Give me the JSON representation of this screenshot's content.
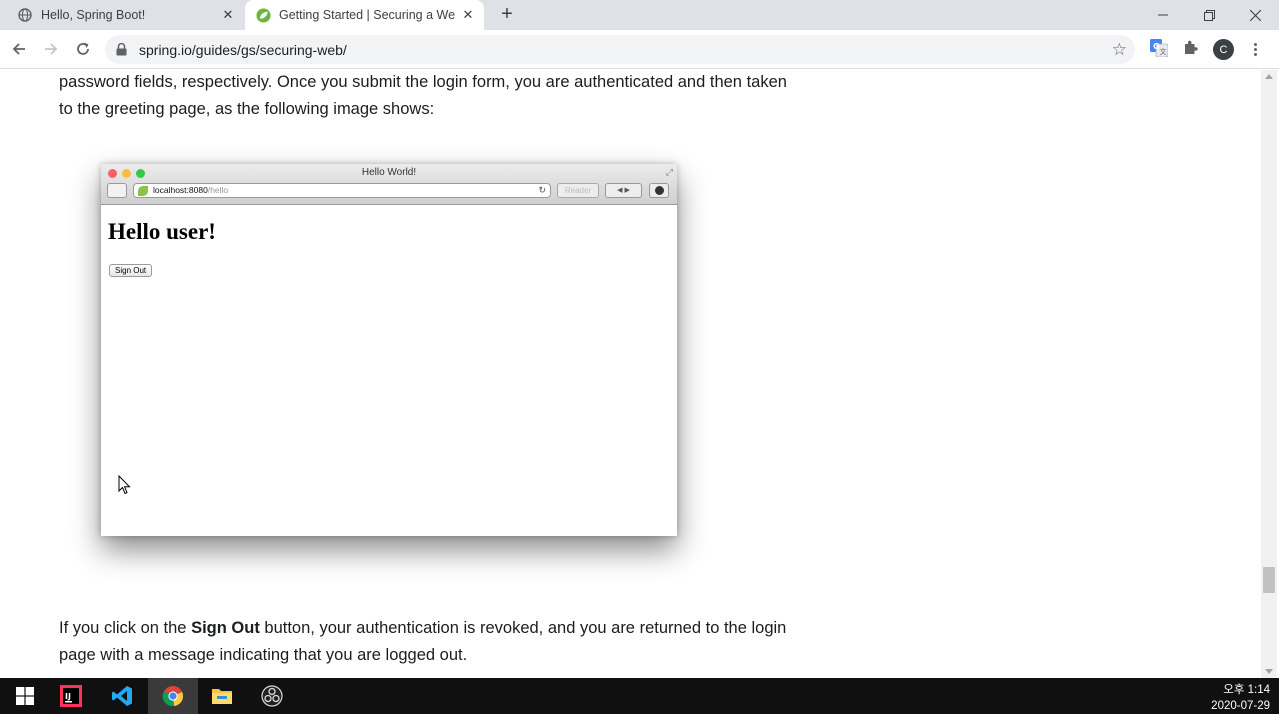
{
  "browser": {
    "tabs": [
      {
        "title": "Hello, Spring Boot!",
        "icon": "globe-icon",
        "active": false
      },
      {
        "title": "Getting Started | Securing a We",
        "icon": "spring-leaf-icon",
        "active": true
      }
    ],
    "new_tab": "+",
    "url": "spring.io/guides/gs/securing-web/",
    "profile_initial": "C"
  },
  "article": {
    "para_top_line1": "password fields, respectively. Once you submit the login form, you are authenticated and then taken",
    "para_top_line2": "to the greeting page, as the following image shows:",
    "para_bottom_pre": "If you click on the ",
    "para_bottom_bold": "Sign Out",
    "para_bottom_post": " button, your authentication is revoked, and you are returned to the login",
    "para_bottom_line2": "page with a message indicating that you are logged out."
  },
  "embedded_screenshot": {
    "window_title": "Hello World!",
    "address_host": "localhost:8080",
    "address_path": "/hello",
    "reader_label": "Reader",
    "nav_arrows": "◀ ▶",
    "heading": "Hello user!",
    "sign_out_label": "Sign Out"
  },
  "taskbar": {
    "apps": [
      "windows-start-icon",
      "intellij-icon",
      "vscode-icon",
      "chrome-icon",
      "file-explorer-icon",
      "obs-icon"
    ],
    "time": "오후 1:14",
    "date": "2020-07-29"
  },
  "colors": {
    "tab_strip": "#dee1e6",
    "omnibox": "#f1f3f4",
    "taskbar": "#101010",
    "spring_green": "#6db33f"
  }
}
